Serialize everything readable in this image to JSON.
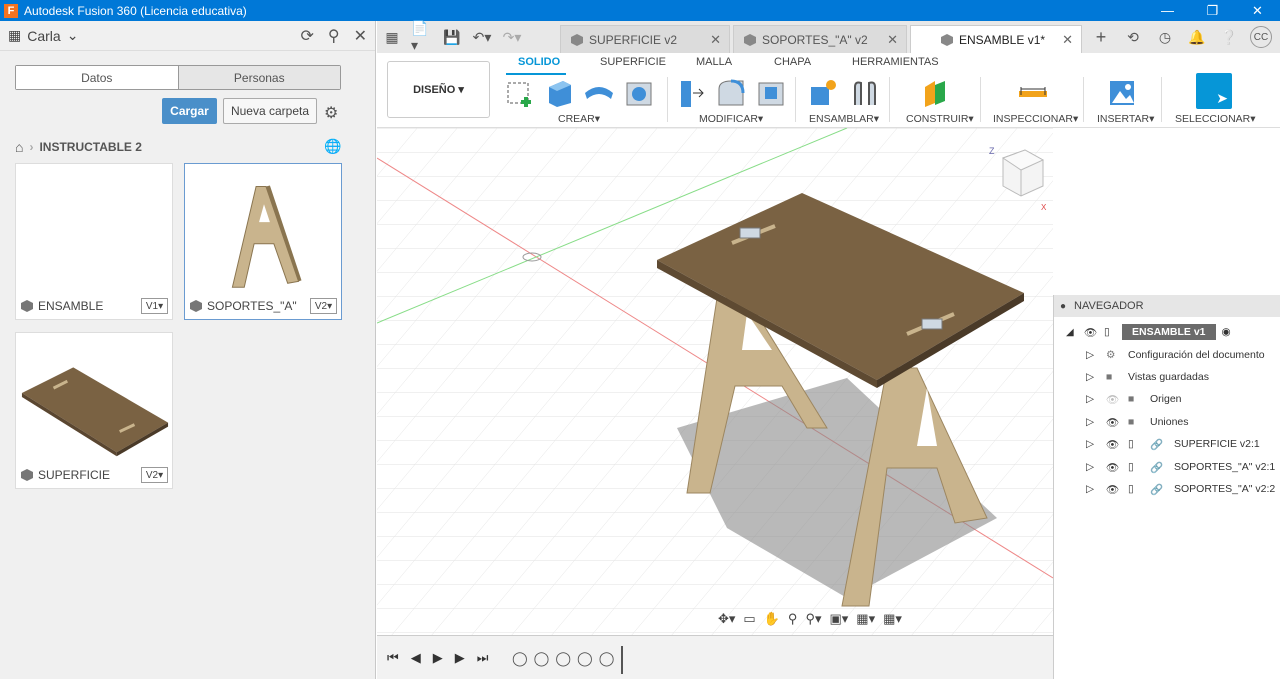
{
  "window": {
    "title": "Autodesk Fusion 360 (Licencia educativa)",
    "logo": "F"
  },
  "left_panel": {
    "user": "Carla",
    "tabs": [
      "Datos",
      "Personas"
    ],
    "upload_label": "Cargar",
    "new_folder_label": "Nueva carpeta",
    "breadcrumb": "INSTRUCTABLE 2",
    "files": [
      {
        "name": "ENSAMBLE",
        "version": "V1"
      },
      {
        "name": "SOPORTES_\"A\"",
        "version": "V2"
      },
      {
        "name": "SUPERFICIE",
        "version": "V2"
      }
    ]
  },
  "doc_tabs": [
    {
      "label": "SUPERFICIE v2"
    },
    {
      "label": "SOPORTES_\"A\" v2"
    },
    {
      "label": "ENSAMBLE v1*"
    }
  ],
  "avatar": "CC",
  "ribbon": {
    "workspace": "DISEÑO",
    "tabs": [
      "SOLIDO",
      "SUPERFICIE",
      "MALLA",
      "CHAPA",
      "HERRAMIENTAS"
    ],
    "groups": [
      "CREAR",
      "MODIFICAR",
      "ENSAMBLAR",
      "CONSTRUIR",
      "INSPECCIONAR",
      "INSERTAR",
      "SELECCIONAR"
    ]
  },
  "navigator": {
    "title": "NAVEGADOR",
    "root": "ENSAMBLE v1",
    "items": [
      "Configuración del documento",
      "Vistas guardadas",
      "Origen",
      "Uniones",
      "SUPERFICIE v2:1",
      "SOPORTES_\"A\" v2:1",
      "SOPORTES_\"A\" v2:2"
    ]
  },
  "colors": {
    "accent": "#0696d7",
    "titlebar": "#0078d7",
    "wood": "#7a6243",
    "wood_light": "#c9b48d"
  }
}
